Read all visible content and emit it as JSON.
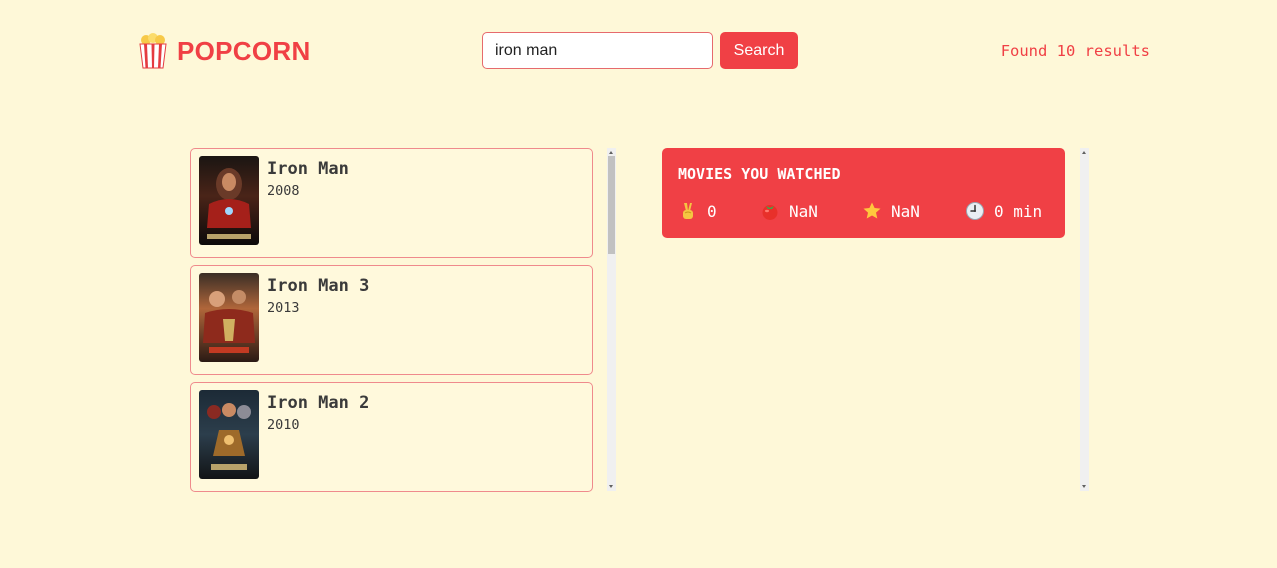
{
  "header": {
    "logo_text": "POPCORN",
    "search_value": "iron man",
    "search_button": "Search",
    "results": "Found 10 results"
  },
  "movies": [
    {
      "title": "Iron Man",
      "year": "2008"
    },
    {
      "title": "Iron Man 3",
      "year": "2013"
    },
    {
      "title": "Iron Man 2",
      "year": "2010"
    }
  ],
  "summary": {
    "title": "MOVIES YOU WATCHED",
    "stats": [
      {
        "icon": "victory-hand-icon",
        "value": "0"
      },
      {
        "icon": "tomato-icon",
        "value": "NaN"
      },
      {
        "icon": "star-icon",
        "value": "NaN"
      },
      {
        "icon": "clock-icon",
        "value": "0 min"
      }
    ]
  },
  "colors": {
    "accent": "#f04045",
    "background": "#fef8d8",
    "text": "#3a3a3a"
  }
}
